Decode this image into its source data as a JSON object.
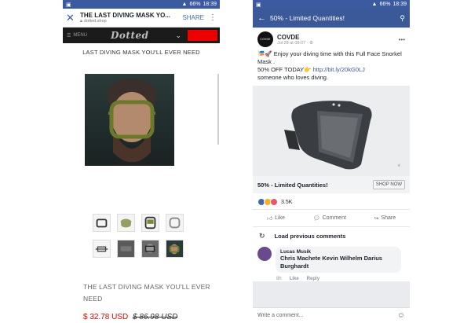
{
  "left": {
    "status": {
      "signal": "N",
      "battery": "66%",
      "time": "18:39"
    },
    "header": {
      "title": "THE LAST DIVING MASK YO...",
      "url": "dotted.shop",
      "share_label": "SHARE",
      "more_icon": "more-vertical-icon"
    },
    "nav": {
      "menu_label": "MENU",
      "logo_text": "Dotted"
    },
    "banner": "LAST DIVING MASK YOU'LL EVER NEED",
    "product": {
      "title": "THE LAST DIVING MASK YOU'LL EVER NEED",
      "price_now": "$ 32.78 USD",
      "price_old": "$ 86.98 USD"
    }
  },
  "right": {
    "status": {
      "signal": "N",
      "battery": "66%",
      "time": "18:39"
    },
    "header": {
      "title": "50% - Limited Quantities!"
    },
    "post": {
      "page_name": "COVDE",
      "avatar_text": "COVDE",
      "timestamp": "Jul 28 at 09:07 · ⚙",
      "text_line1": "🎏🚀 Enjoy your diving time with this Full Face Snorkel Mask .",
      "text_line2": "50% OFF TODAY👉",
      "link": "http://bit.ly/20kG0LJ",
      "text_line3": "someone who loves diving.",
      "cta_label": "50% - Limited Quantities!",
      "cta_button": "SHOP NOW",
      "reaction_count": "3.5K",
      "actions": {
        "like": "Like",
        "comment": "Comment",
        "share": "Share"
      },
      "load_previous": "Load previous comments"
    },
    "comment": {
      "author": "Lucas Musik",
      "text": "Chris Machete Kevin Wilhelm Darius Burghardt",
      "time": "8h",
      "like": "Like",
      "reply": "Reply"
    },
    "composer": {
      "placeholder": "Write a comment..."
    }
  },
  "colors": {
    "facebook_blue": "#3b5998",
    "price_red": "#e00000",
    "status_blue": "#3b5aa0"
  }
}
